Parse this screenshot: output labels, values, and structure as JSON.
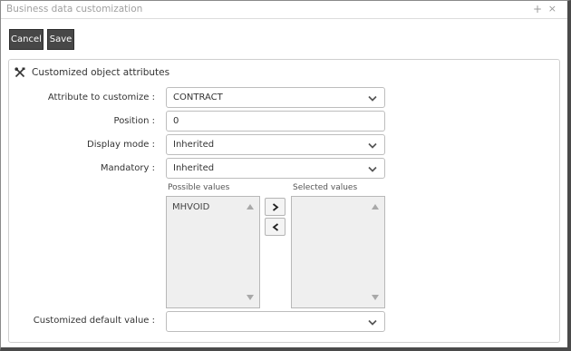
{
  "window": {
    "title": "Business data customization",
    "maximize_glyph": "+",
    "close_glyph": "×"
  },
  "toolbar": {
    "cancel_label": "Cancel",
    "save_label": "Save"
  },
  "panel": {
    "title": "Customized object attributes",
    "icon": "tools-icon"
  },
  "form": {
    "attribute": {
      "label": "Attribute to customize :",
      "value": "CONTRACT"
    },
    "position": {
      "label": "Position :",
      "value": "0"
    },
    "display_mode": {
      "label": "Display mode :",
      "value": "Inherited"
    },
    "mandatory": {
      "label": "Mandatory :",
      "value": "Inherited"
    },
    "possible_values": {
      "label": "Possible values",
      "items": [
        "MHVOID"
      ]
    },
    "selected_values": {
      "label": "Selected values",
      "items": []
    },
    "move_right_glyph": ">",
    "move_left_glyph": "<",
    "default_value": {
      "label": "Customized default value :",
      "value": ""
    }
  }
}
